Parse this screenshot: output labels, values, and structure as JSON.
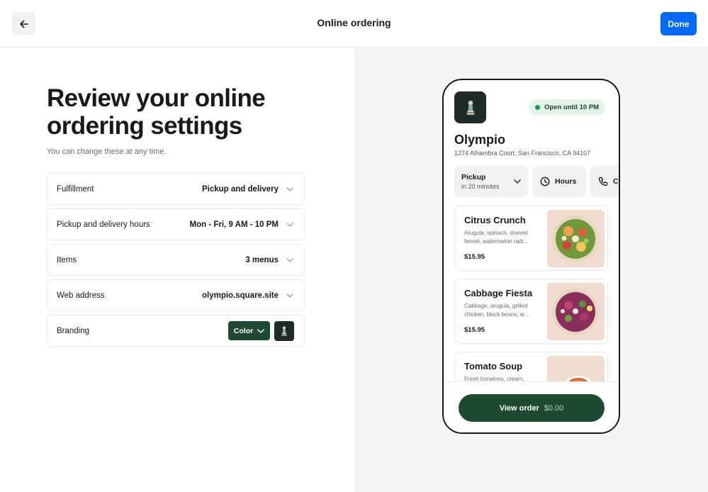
{
  "header": {
    "title": "Online ordering",
    "back_icon": "arrow-left-icon",
    "done_label": "Done",
    "accent": "#006aff"
  },
  "intro": {
    "heading": "Review your online ordering settings",
    "subtitle": "You can change these at any time."
  },
  "settings": [
    {
      "label": "Fulfillment",
      "value": "Pickup and delivery"
    },
    {
      "label": "Pickup and delivery hours",
      "value": "Mon - Fri, 9 AM - 10 PM"
    },
    {
      "label": "Items",
      "value": "3 menus"
    },
    {
      "label": "Web address",
      "value": "olympio.square.site"
    }
  ],
  "branding": {
    "label": "Branding",
    "color_button": "Color",
    "brand_color": "#1e4a32"
  },
  "preview": {
    "status": "Open until 10 PM",
    "status_color": "#1a9e4b",
    "name": "Olympio",
    "address": "1274 Alhambra Court, San Francisco, CA 94107",
    "chips": {
      "pickup_title": "Pickup",
      "pickup_sub": "in 20 minutes",
      "hours": "Hours",
      "call": "Call"
    },
    "items": [
      {
        "name": "Citrus Crunch",
        "desc": "Arugula, spinach, shaved fennel, watermelon radi...",
        "price": "$15.95"
      },
      {
        "name": "Cabbage Fiesta",
        "desc": "Cabbage, arugula, grilled chicken, black beans, w...",
        "price": "$15.95"
      },
      {
        "name": "Tomato Soup",
        "desc": "Fresh tomatoes, cream,",
        "price": ""
      }
    ],
    "order_button": "View order",
    "order_total": "$0.00"
  }
}
